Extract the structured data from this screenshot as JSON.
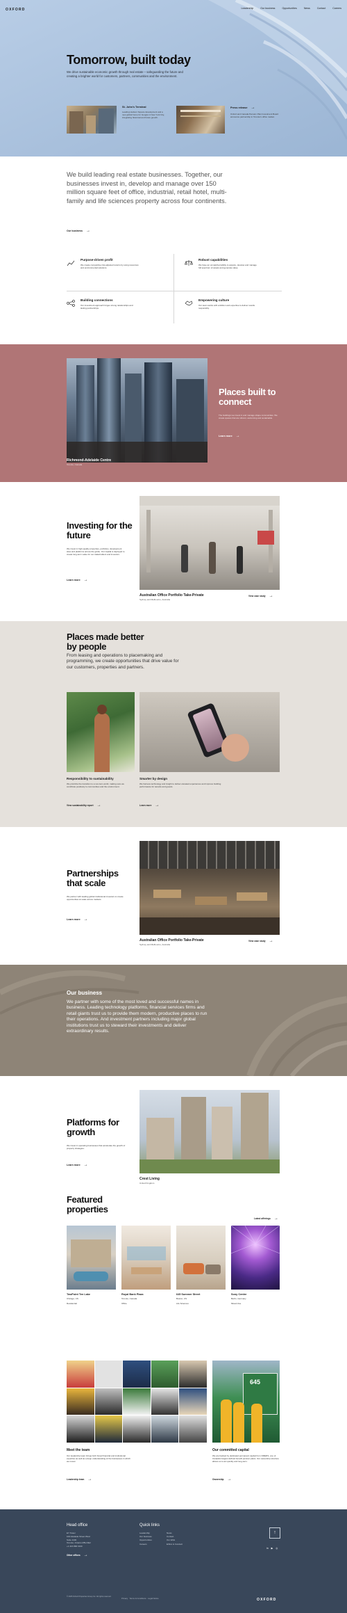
{
  "colors": {
    "hero_bg": "#a9c1de",
    "places_bg": "#b07576",
    "people_bg": "#e5e1dc",
    "business_bg": "#8e8477",
    "footer_bg": "#39475a"
  },
  "header": {
    "logo": "OXFORD",
    "nav": [
      "Leadership",
      "Our business",
      "Opportunities",
      "News",
      "Contact",
      "Careers"
    ]
  },
  "hero": {
    "title": "Tomorrow, built today",
    "subtitle": "We drive sustainable economic growth through real estate – safeguarding the future and creating a brighter world for customers, partners, communities and the environment.",
    "cards": [
      {
        "title": "St. John's Terminal",
        "text": "Leading Hudson Square development and a new global home for Google in New York City, integrating historical and future growth."
      },
      {
        "title": "Press release",
        "text": "Oxford and Canada Pension Plan Investment Board announce partnership in Toronto's office market."
      }
    ]
  },
  "intro": {
    "text": "We build leading real estate businesses. Together, our businesses invest in, develop and manage over 150 million square feet of office, industrial, retail hotel, multi-family and life sciences property across four continents.",
    "link": "Our business",
    "features": [
      {
        "icon": "chart-icon",
        "title": "Purpose-driven profit",
        "text": "We create competitive risk-adjusted returns by using resources and environmental solutions."
      },
      {
        "icon": "scale-icon",
        "title": "Robust capabilities",
        "text": "We have an unmatched ability to acquire, develop and manage full spectrum of assets and generate value."
      },
      {
        "icon": "network-icon",
        "title": "Building connections",
        "text": "Our investment approach forges strong relationships and lasting partnerships."
      },
      {
        "icon": "handshake-icon",
        "title": "Empowering culture",
        "text": "Our team works with ambition and expertise to deliver results responsibly."
      }
    ]
  },
  "places": {
    "title": "Places built to connect",
    "text": "The buildings we invest in and manage shape communities. We create spaces that are vibrant, welcoming and sustainable.",
    "link": "Learn more",
    "caption": "Richmond-Adelaide Centre",
    "caption_sub": "Toronto, Canada"
  },
  "investing": {
    "title": "Investing for the future",
    "text": "We invest in high-quality properties, portfolios, development sites and platforms across the globe. Our capital is deployed to create long-term value for our stakeholders and investors.",
    "link": "Learn more",
    "caption": "Australian Office Portfolio Take-Private",
    "caption_sub": "Sydney and Melbourne, Australia",
    "caption_link": "View case study"
  },
  "people": {
    "title": "Places made better by people",
    "text": "From leasing and operations to placemaking and programming, we create opportunities that drive value for our customers, properties and partners.",
    "items": [
      {
        "title": "Responsibility to sustainability",
        "text": "We prioritize the transition to a net-zero world, making sure we contribute positively to communities and the environment.",
        "link": "View sustainability report"
      },
      {
        "title": "Smarter by design",
        "text": "We harness technology and insight to deliver elevated experiences and improve building performance for tenants and guests.",
        "link": "Learn more"
      }
    ]
  },
  "partnerships": {
    "title": "Partnerships that scale",
    "text": "We partner with leading global institutional investors to create opportunities at scale across markets.",
    "link": "Learn more",
    "caption": "Australian Office Portfolio Take-Private",
    "caption_sub": "Sydney and Melbourne, Australia",
    "caption_link": "View case study"
  },
  "business": {
    "title": "Our business",
    "text": "We partner with some of the most loved and successful names in business. Leading technology platforms, financial services firms and retail giants trust us to provide them modern, productive places to run their operations. And investment partners including major global institutions trust us to steward their investments and deliver extraordinary results."
  },
  "platforms": {
    "title": "Platforms for growth",
    "text": "We invest in operating businesses that accelerate the growth of property strategies.",
    "link": "Learn more",
    "caption": "Crest Living",
    "caption_sub": "United Kingdom"
  },
  "featured": {
    "title": "Featured properties",
    "link": "Latest offerings",
    "items": [
      {
        "name": "TwoPoint Ten Lake",
        "city": "Chicago, US",
        "type": "Residential"
      },
      {
        "name": "Royal Bank Plaza",
        "city": "Toronto, Canada",
        "type": "Office"
      },
      {
        "name": "645 Summer Street",
        "city": "Boston, US",
        "type": "Life Sciences"
      },
      {
        "name": "Sony Centre",
        "city": "Berlin, Germany",
        "type": "Mixed-Use"
      }
    ]
  },
  "team": {
    "title": "Meet the team",
    "text": "Our leadership team brings both broad financial and institutional expertise as well as a deep understanding of the businesses in which we invest.",
    "link": "Leadership team"
  },
  "capital": {
    "title": "Our committed capital",
    "text": "We are backed by dedicated permanent capital from OMERS, one of Canada's largest defined benefit pension plans. Our ownership structure allows us to act quickly and long-term.",
    "link": "Ownership"
  },
  "footer": {
    "head_office_title": "Head office",
    "address": [
      "EY Tower",
      "100 Adelaide Street West",
      "Suite 1100",
      "Toronto, Ontario M5H 0E2",
      "+1 416 868 3100"
    ],
    "offices_link": "Other offices",
    "quick_links_title": "Quick links",
    "quick_col1": [
      "Leadership",
      "Our business",
      "Opportunities",
      "Careers"
    ],
    "quick_col2": [
      "News",
      "Contact",
      "Our ESG",
      "Ethics & Conduct"
    ],
    "copyright": "© 2025 Oxford Properties Group Inc. All rights reserved.",
    "legal": "Privacy   Terms & Conditions   Legal Notice",
    "logo": "OXFORD",
    "top_button": "↑",
    "social": [
      "in",
      "▶",
      "◎"
    ]
  }
}
